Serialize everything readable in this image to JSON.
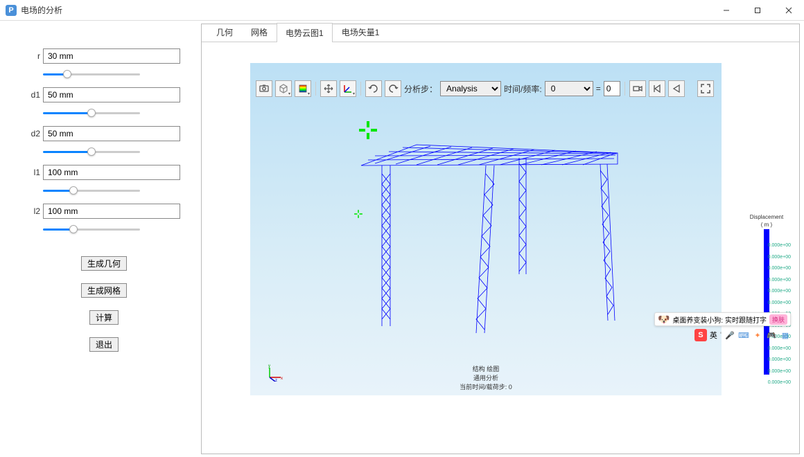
{
  "window": {
    "title": "电场的分析",
    "app_icon_letter": "P"
  },
  "sidebar": {
    "params": [
      {
        "label": "r",
        "value": "30 mm",
        "fill": 23
      },
      {
        "label": "d1",
        "value": "50 mm",
        "fill": 50
      },
      {
        "label": "d2",
        "value": "50 mm",
        "fill": 50
      },
      {
        "label": "l1",
        "value": "100 mm",
        "fill": 30
      },
      {
        "label": "l2",
        "value": "100 mm",
        "fill": 30
      }
    ],
    "buttons": {
      "generate_geometry": "生成几何",
      "generate_mesh": "生成网格",
      "compute": "计算",
      "exit": "退出"
    }
  },
  "tabs": {
    "items": [
      "几何",
      "网格",
      "电势云图1",
      "电场矢量1"
    ],
    "active_index": 2
  },
  "toolbar": {
    "step_label": "分析步：",
    "step_value": "Analysis",
    "time_label": "时间/频率:",
    "time_value": "0",
    "eq_label": "=",
    "frame_value": "0"
  },
  "viewport": {
    "caption_line1": "结构 绘图",
    "caption_line2": "通用分析",
    "caption_line3": "当前时间/载荷步: 0"
  },
  "legend": {
    "title": "Displacement",
    "unit": "( m )",
    "values": [
      "0.000e+00",
      "0.000e+00",
      "0.000e+00",
      "0.000e+00",
      "0.000e+00",
      "0.000e+00",
      "0.000e+00",
      "0.000e+00",
      "0.000e+00",
      "0.000e+00",
      "0.000e+00",
      "0.000e+00",
      "0.000e+00"
    ]
  },
  "ime": {
    "banner_text": "桌面养变装小狗: 实时跟随打字",
    "banner_badge": "换肤",
    "lang": "英"
  }
}
